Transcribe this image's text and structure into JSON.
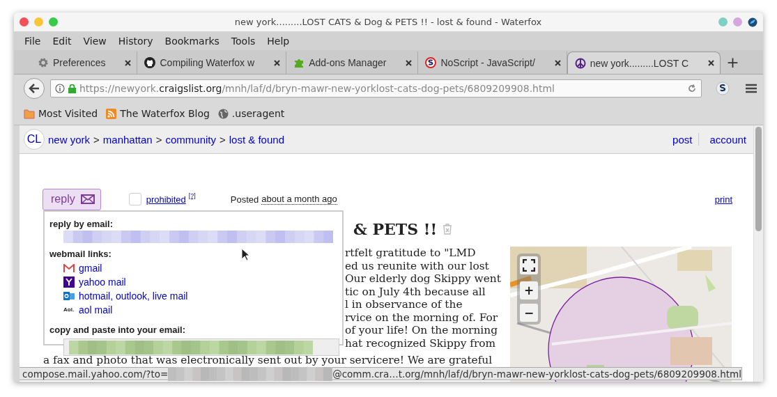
{
  "window": {
    "title": "new york.........LOST CATS & Dog & PETS !! - lost & found - Waterfox"
  },
  "menu": [
    "File",
    "Edit",
    "View",
    "History",
    "Bookmarks",
    "Tools",
    "Help"
  ],
  "tabs": [
    {
      "label": "Preferences",
      "kind": "gear",
      "selected": false
    },
    {
      "label": "Compiling Waterfox w",
      "kind": "github",
      "selected": false
    },
    {
      "label": "Add-ons Manager",
      "kind": "puzzle",
      "selected": false
    },
    {
      "label": "NoScript - JavaScript/",
      "kind": "noscript",
      "selected": false
    },
    {
      "label": "new york.........LOST C",
      "kind": "peace",
      "selected": true
    }
  ],
  "new_tab": "+",
  "url": {
    "prefix": "https://newyork.",
    "domain": "craigslist.org",
    "path": "/mnh/laf/d/bryn-mawr-new-yorklost-cats-dog-pets/6809209908.html"
  },
  "bookmarks": [
    {
      "label": "Most Visited",
      "kind": "folder"
    },
    {
      "label": "The Waterfox Blog",
      "kind": "rss"
    },
    {
      "label": ".useragent",
      "kind": "globe"
    }
  ],
  "site": {
    "logo": "CL",
    "breadcrumbs": [
      "new york",
      "manhattan",
      "community",
      "lost & found"
    ],
    "separator": ">",
    "right_links": [
      "post",
      "account"
    ]
  },
  "postbar": {
    "reply": "reply",
    "prohibited_checked": false,
    "prohibited": "prohibited",
    "help": "[?]",
    "posted_label": "Posted",
    "posted": "about a month ago",
    "print": "print"
  },
  "popup": {
    "reply_label": "reply by email:",
    "webmail_label": "webmail links:",
    "webmail": [
      {
        "label": "gmail",
        "kind": "gmail"
      },
      {
        "label": "yahoo mail",
        "kind": "yahoo"
      },
      {
        "label": "hotmail, outlook, live mail",
        "kind": "outlook"
      },
      {
        "label": "aol mail",
        "kind": "aol",
        "icon_text": "Aol."
      }
    ],
    "copy_label": "copy and paste into your email:"
  },
  "post": {
    "title": "& PETS !!",
    "lines": [
      "rtfelt gratitude to \"LMD",
      "ed us reunite with our lost",
      "Our elderly dog Skippy went",
      "tic on July 4th because all",
      "l in observance of the",
      "rvice on the morning of. For",
      "of your life! On the morning",
      "hat recognized Skippy from"
    ],
    "line_below": "a fax and photo that was electronically sent out by your servicere! We are grateful"
  },
  "map": {
    "kind": "picture",
    "zoom_in": "+",
    "zoom_out": "−"
  },
  "status_bar": {
    "before": "compose.mail.yahoo.com/?to=",
    "after": "@comm.cra…t.org/mnh/laf/d/bryn-mawr-new-yorklost-cats-dog-pets/6809209908.html"
  }
}
